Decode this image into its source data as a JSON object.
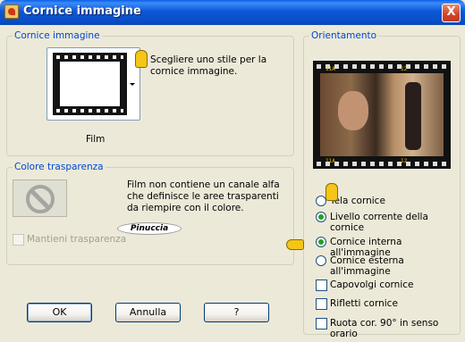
{
  "window": {
    "title": "Cornice immagine",
    "close_label": "X"
  },
  "frame_group": {
    "label": "Cornice immagine",
    "hint": "Scegliere uno stile per la cornice immagine.",
    "selected_frame": "Film"
  },
  "transparency_group": {
    "label": "Colore trasparenza",
    "message": "Film non contiene un canale alfa che definisce le aree trasparenti da riempire con il colore.",
    "keep_transparency_label": "Mantieni trasparenza",
    "keep_transparency_checked": false,
    "keep_transparency_enabled": false
  },
  "watermark": {
    "text": "Pinuccia"
  },
  "orientation_group": {
    "label": "Orientamento",
    "film_codes": [
      "11A",
      "12",
      "11A",
      "12"
    ],
    "layer_options": [
      {
        "label": "Tela cornice",
        "checked": false
      },
      {
        "label": "Livello corrente della cornice",
        "checked": true
      }
    ],
    "placement_options": [
      {
        "label": "Cornice interna all'immagine",
        "checked": true
      },
      {
        "label": "Cornice esterna all'immagine",
        "checked": false
      }
    ],
    "checkboxes": [
      {
        "label": "Capovolgi cornice",
        "checked": false
      },
      {
        "label": "Rifletti cornice",
        "checked": false
      },
      {
        "label": "Ruota cor. 90° in senso orario",
        "checked": false
      }
    ]
  },
  "buttons": {
    "ok": "OK",
    "cancel": "Annulla",
    "help": "?"
  },
  "colors": {
    "title_bar": "#0A4FC8",
    "window_bg": "#ECE9D8",
    "group_label": "#0046D5",
    "radio_selected": "#21A121",
    "pointer_hand": "#F5C518"
  }
}
